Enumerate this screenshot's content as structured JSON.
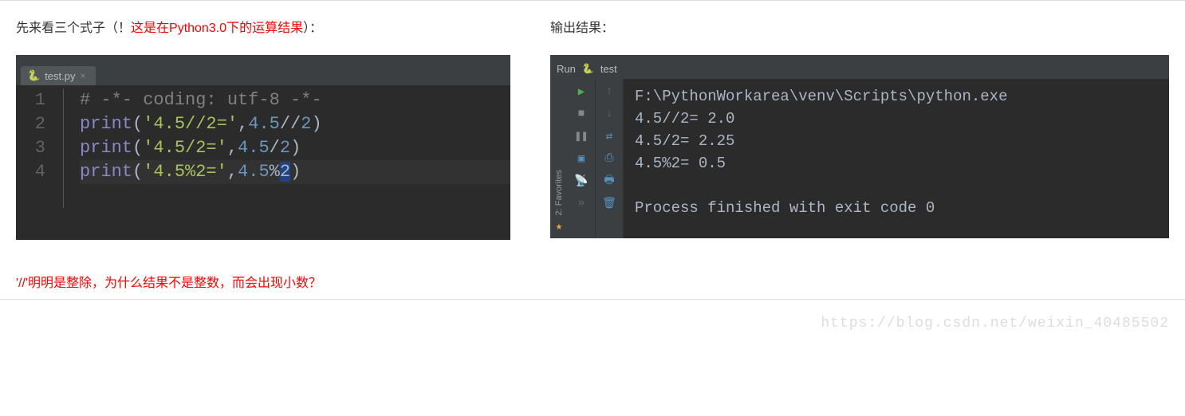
{
  "intro": {
    "prefix": "先来看三个式子（！",
    "red": "这是在Python3.0下的运算结果",
    "suffix": "）："
  },
  "output_label": "输出结果：",
  "editor": {
    "tab_name": "test.py",
    "lines": [
      {
        "n": "1",
        "tokens": [
          {
            "cls": "tok-comment",
            "t": "# -*- coding: utf-8 -*-"
          }
        ]
      },
      {
        "n": "2",
        "tokens": [
          {
            "cls": "tok-kw",
            "t": "print"
          },
          {
            "cls": "tok-op",
            "t": "("
          },
          {
            "cls": "tok-str",
            "t": "'4.5//2='"
          },
          {
            "cls": "tok-op",
            "t": ","
          },
          {
            "cls": "tok-num",
            "t": "4.5"
          },
          {
            "cls": "tok-op",
            "t": "//"
          },
          {
            "cls": "tok-num",
            "t": "2"
          },
          {
            "cls": "tok-op",
            "t": ")"
          }
        ]
      },
      {
        "n": "3",
        "tokens": [
          {
            "cls": "tok-kw",
            "t": "print"
          },
          {
            "cls": "tok-op",
            "t": "("
          },
          {
            "cls": "tok-str",
            "t": "'4.5/2='"
          },
          {
            "cls": "tok-op",
            "t": ","
          },
          {
            "cls": "tok-num",
            "t": "4.5"
          },
          {
            "cls": "tok-op",
            "t": "/"
          },
          {
            "cls": "tok-num",
            "t": "2"
          },
          {
            "cls": "tok-op",
            "t": ")"
          }
        ]
      },
      {
        "n": "4",
        "hl": true,
        "tokens": [
          {
            "cls": "tok-kw",
            "t": "print"
          },
          {
            "cls": "tok-op",
            "t": "("
          },
          {
            "cls": "tok-str",
            "t": "'4.5%2='"
          },
          {
            "cls": "tok-op",
            "t": ","
          },
          {
            "cls": "tok-num",
            "t": "4.5"
          },
          {
            "cls": "tok-op",
            "t": "%"
          },
          {
            "cls": "tok-num cursor-box",
            "t": "2"
          },
          {
            "cls": "tok-op",
            "t": ")"
          }
        ]
      }
    ]
  },
  "run": {
    "header": "Run",
    "config": "test",
    "sidebar_label": "2: Favorites",
    "output": [
      "F:\\PythonWorkarea\\venv\\Scripts\\python.exe",
      "4.5//2= 2.0",
      "4.5/2= 2.25",
      "4.5%2= 0.5",
      "",
      "Process finished with exit code 0"
    ]
  },
  "question": "'//'明明是整除，为什么结果不是整数，而会出现小数？",
  "watermark": "https://blog.csdn.net/weixin_40485502"
}
